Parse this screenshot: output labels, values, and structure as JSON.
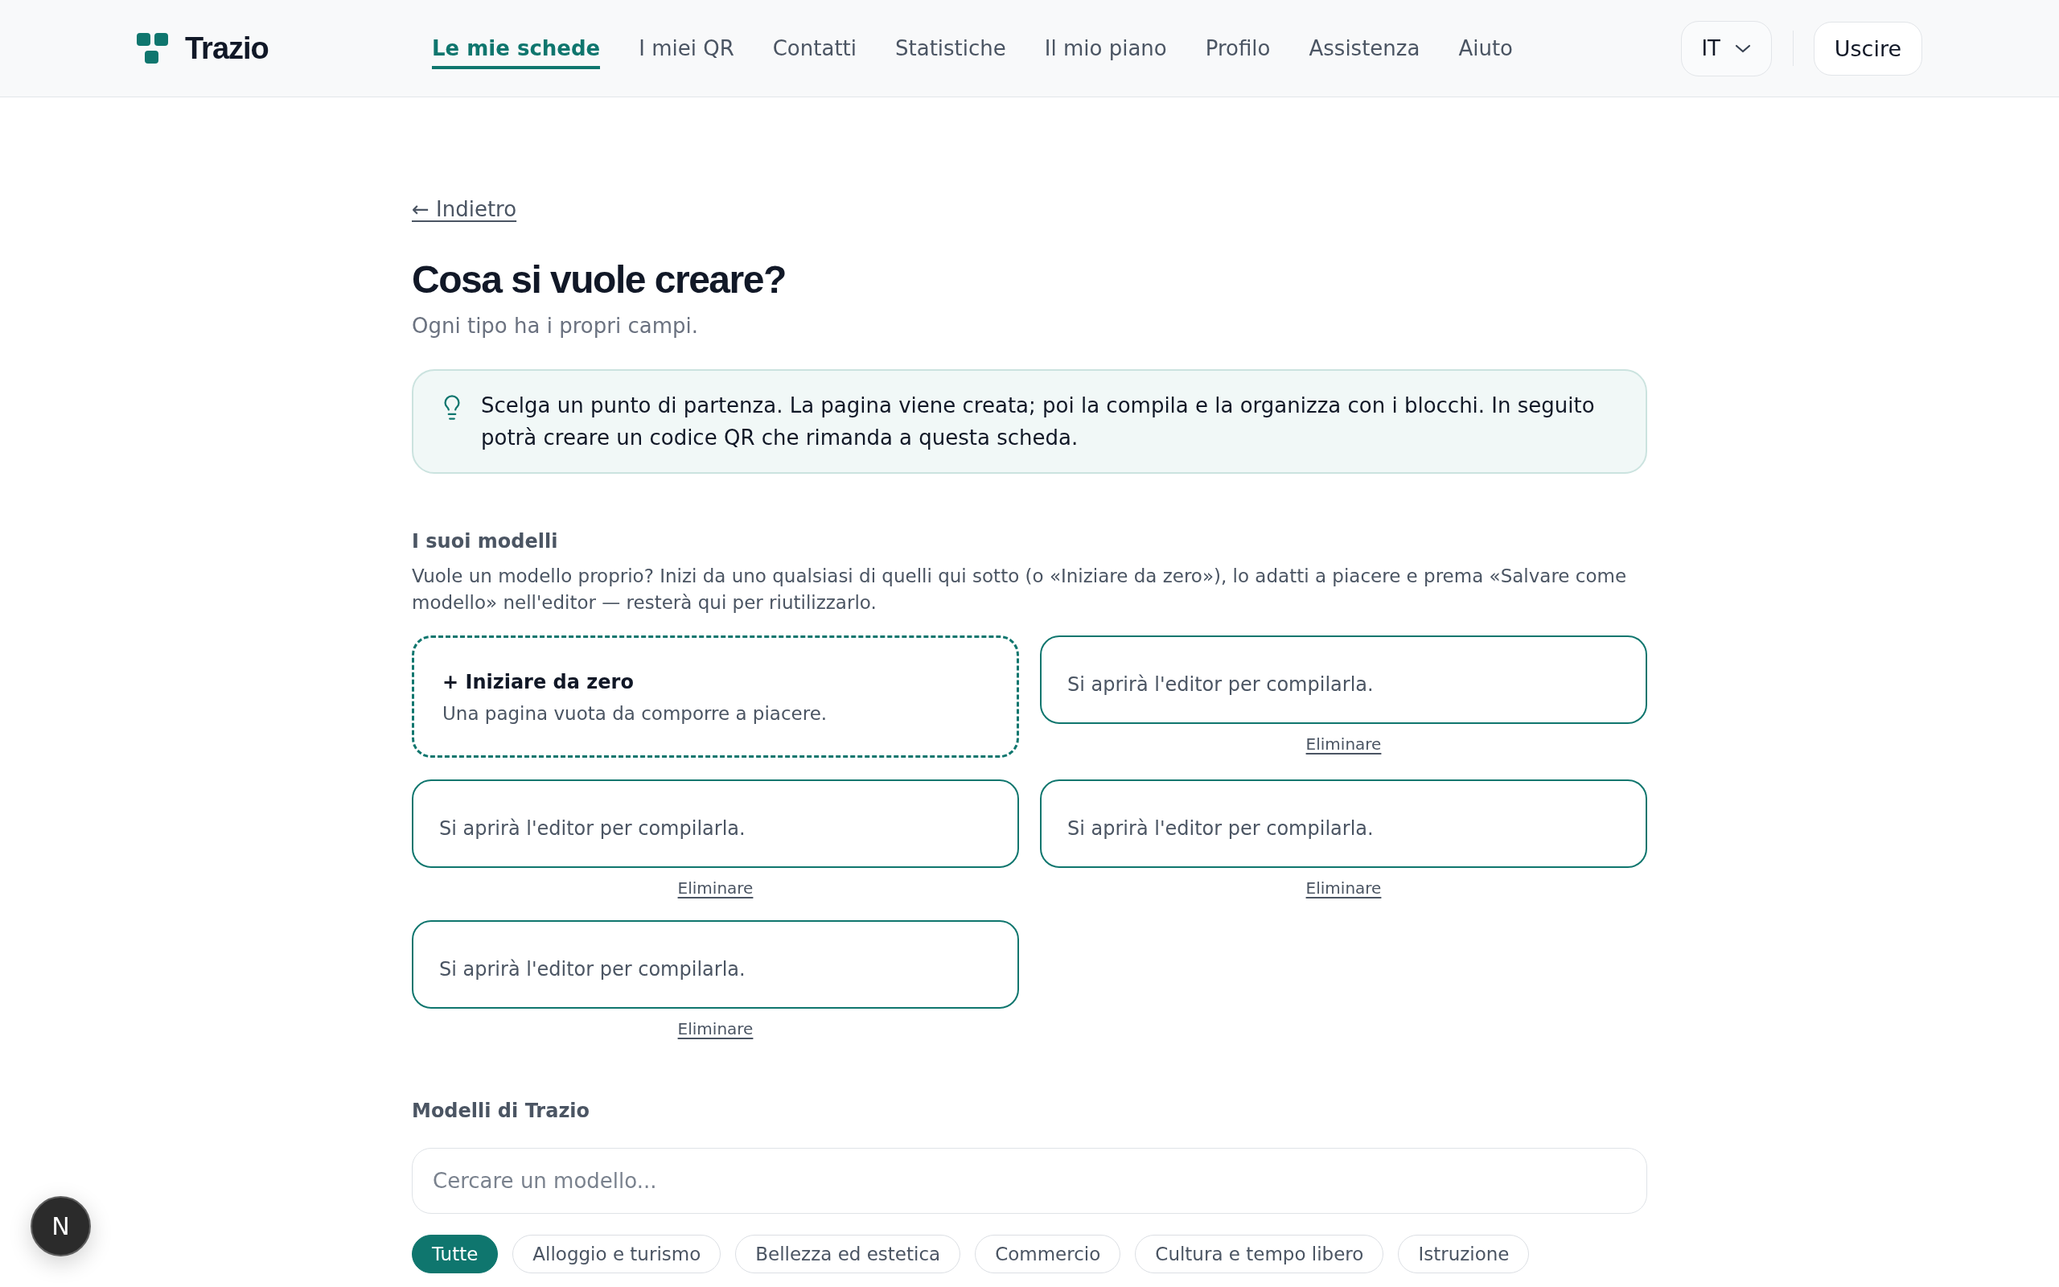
{
  "header": {
    "logo_text": "Trazio",
    "nav": [
      {
        "label": "Le mie schede",
        "selected": true
      },
      {
        "label": "I miei QR",
        "selected": false
      },
      {
        "label": "Contatti",
        "selected": false
      },
      {
        "label": "Statistiche",
        "selected": false
      },
      {
        "label": "Il mio piano",
        "selected": false
      },
      {
        "label": "Profilo",
        "selected": false
      },
      {
        "label": "Assistenza",
        "selected": false
      },
      {
        "label": "Aiuto",
        "selected": false
      }
    ],
    "language": "IT",
    "logout": "Uscire"
  },
  "back_link": "← Indietro",
  "page": {
    "title": "Cosa si vuole creare?",
    "subtitle": "Ogni tipo ha i propri campi."
  },
  "info_box": {
    "text": "Scelga un punto di partenza. La pagina viene creata; poi la compila e la organizza con i blocchi. In seguito potrà creare un codice QR che rimanda a questa scheda."
  },
  "my_templates": {
    "heading": "I suoi modelli",
    "description": "Vuole un modello proprio? Inizi da uno qualsiasi di quelli qui sotto (o «Iniziare da zero»), lo adatti a piacere e prema «Salvare come modello» nell'editor — resterà qui per riutilizzarlo.",
    "cards": [
      {
        "kind": "blank",
        "title": "+ Iniziare da zero",
        "description": "Una pagina vuota da comporre a piacere."
      },
      {
        "kind": "saved",
        "description": "Si aprirà l'editor per compilarla.",
        "delete_label": "Eliminare"
      },
      {
        "kind": "saved",
        "description": "Si aprirà l'editor per compilarla.",
        "delete_label": "Eliminare"
      },
      {
        "kind": "saved",
        "description": "Si aprirà l'editor per compilarla.",
        "delete_label": "Eliminare"
      },
      {
        "kind": "saved",
        "description": "Si aprirà l'editor per compilarla.",
        "delete_label": "Eliminare"
      }
    ]
  },
  "trazio_templates": {
    "heading": "Modelli di Trazio",
    "search": {
      "placeholder": "Cercare un modello..."
    },
    "categories": [
      {
        "label": "Tutte",
        "selected": true
      },
      {
        "label": "Alloggio e turismo",
        "selected": false
      },
      {
        "label": "Bellezza ed estetica",
        "selected": false
      },
      {
        "label": "Commercio",
        "selected": false
      },
      {
        "label": "Cultura e tempo libero",
        "selected": false
      },
      {
        "label": "Istruzione",
        "selected": false
      }
    ]
  },
  "dev_indicator": {
    "label": "N"
  }
}
